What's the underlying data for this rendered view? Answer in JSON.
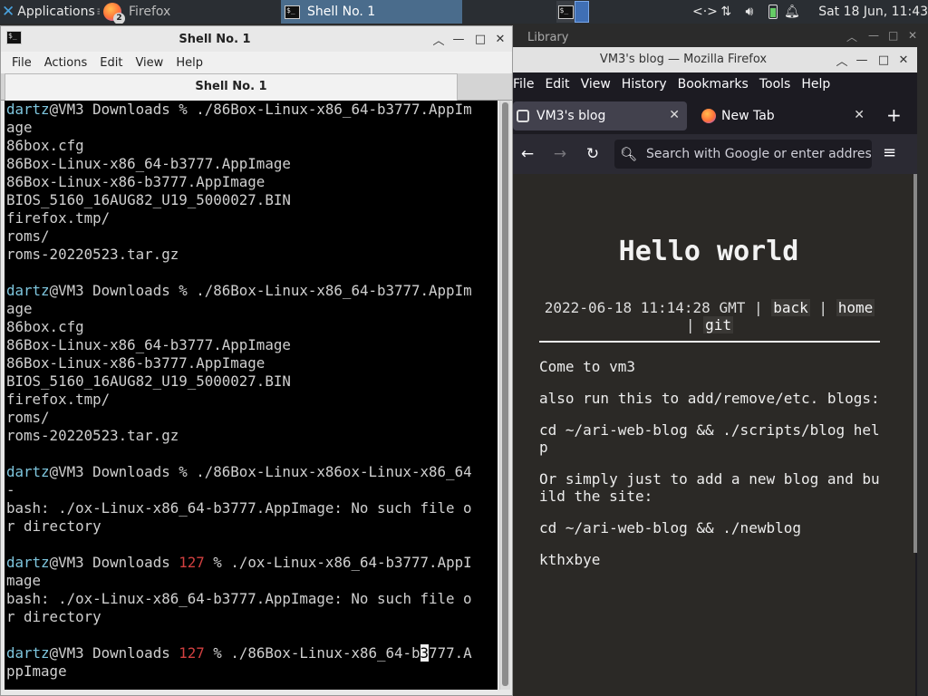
{
  "panel": {
    "applications": "Applications",
    "separator": "≡",
    "firefox_task": "Firefox",
    "firefox_badge": "2",
    "shell_task": "Shell No. 1",
    "clock": "Sat 18 Jun, 11:43"
  },
  "library": {
    "title": "Library"
  },
  "firefox": {
    "title": "VM3's blog — Mozilla Firefox",
    "menu": [
      "File",
      "Edit",
      "View",
      "History",
      "Bookmarks",
      "Tools",
      "Help"
    ],
    "tabs": [
      {
        "label": "VM3's blog",
        "active": true
      },
      {
        "label": "New Tab",
        "active": false
      }
    ],
    "url_placeholder": "Search with Google or enter address",
    "page": {
      "heading": "Hello world",
      "date": "2022-06-18 11:14:28 GMT",
      "link_back": "back",
      "link_home": "home",
      "link_git": "git",
      "paragraphs": [
        "Come to vm3",
        "also run this to add/remove/etc. blogs:",
        "cd ~/ari-web-blog && ./scripts/blog help",
        "Or simply just to add a new blog and build the site:",
        "cd ~/ari-web-blog && ./newblog",
        "kthxbye"
      ]
    }
  },
  "terminal": {
    "title": "Shell No. 1",
    "menu": [
      "File",
      "Actions",
      "Edit",
      "View",
      "Help"
    ],
    "tab": "Shell No. 1",
    "user": "dartz",
    "host_path": "@VM3 Downloads ",
    "lines": [
      {
        "t": "prompt",
        "cmd": "% ./86Box-Linux-x86_64-b3777.AppIm"
      },
      {
        "t": "out",
        "text": "age"
      },
      {
        "t": "out",
        "text": "86box.cfg"
      },
      {
        "t": "out",
        "text": "86Box-Linux-x86_64-b3777.AppImage"
      },
      {
        "t": "out",
        "text": "86Box-Linux-x86-b3777.AppImage"
      },
      {
        "t": "out",
        "text": "BIOS_5160_16AUG82_U19_5000027.BIN"
      },
      {
        "t": "out",
        "text": "firefox.tmp/"
      },
      {
        "t": "out",
        "text": "roms/"
      },
      {
        "t": "out",
        "text": "roms-20220523.tar.gz"
      },
      {
        "t": "out",
        "text": ""
      },
      {
        "t": "prompt",
        "cmd": "% ./86Box-Linux-x86_64-b3777.AppIm"
      },
      {
        "t": "out",
        "text": "age"
      },
      {
        "t": "out",
        "text": "86box.cfg"
      },
      {
        "t": "out",
        "text": "86Box-Linux-x86_64-b3777.AppImage"
      },
      {
        "t": "out",
        "text": "86Box-Linux-x86-b3777.AppImage"
      },
      {
        "t": "out",
        "text": "BIOS_5160_16AUG82_U19_5000027.BIN"
      },
      {
        "t": "out",
        "text": "firefox.tmp/"
      },
      {
        "t": "out",
        "text": "roms/"
      },
      {
        "t": "out",
        "text": "roms-20220523.tar.gz"
      },
      {
        "t": "out",
        "text": ""
      },
      {
        "t": "prompt",
        "cmd": "% ./86Box-Linux-x86ox-Linux-x86_64"
      },
      {
        "t": "out",
        "text": "-"
      },
      {
        "t": "out",
        "text": "bash: ./ox-Linux-x86_64-b3777.AppImage: No such file o"
      },
      {
        "t": "out",
        "text": "r directory"
      },
      {
        "t": "out",
        "text": ""
      },
      {
        "t": "prompt_err",
        "code": "127",
        "cmd": " % ./ox-Linux-x86_64-b3777.AppI"
      },
      {
        "t": "out",
        "text": "mage"
      },
      {
        "t": "out",
        "text": "bash: ./ox-Linux-x86_64-b3777.AppImage: No such file o"
      },
      {
        "t": "out",
        "text": "r directory"
      },
      {
        "t": "out",
        "text": ""
      },
      {
        "t": "prompt_cur",
        "code": "127",
        "pre": " % ./86Box-Linux-x86_64-b",
        "cur": "3",
        "post": "777.A"
      },
      {
        "t": "out",
        "text": "ppImage"
      }
    ]
  }
}
